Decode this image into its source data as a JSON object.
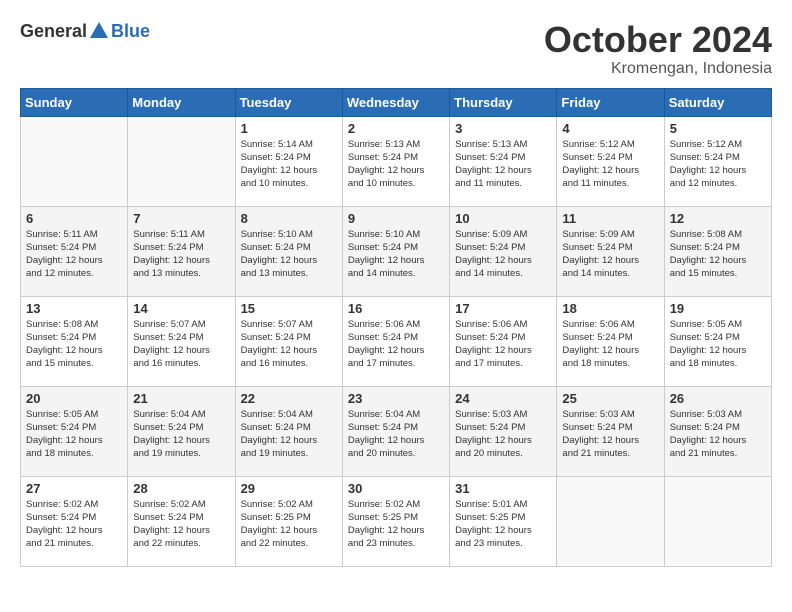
{
  "logo": {
    "general": "General",
    "blue": "Blue"
  },
  "title": "October 2024",
  "location": "Kromengan, Indonesia",
  "days_of_week": [
    "Sunday",
    "Monday",
    "Tuesday",
    "Wednesday",
    "Thursday",
    "Friday",
    "Saturday"
  ],
  "weeks": [
    [
      {
        "day": "",
        "info": ""
      },
      {
        "day": "",
        "info": ""
      },
      {
        "day": "1",
        "sunrise": "5:14 AM",
        "sunset": "5:24 PM",
        "daylight": "12 hours and 10 minutes."
      },
      {
        "day": "2",
        "sunrise": "5:13 AM",
        "sunset": "5:24 PM",
        "daylight": "12 hours and 10 minutes."
      },
      {
        "day": "3",
        "sunrise": "5:13 AM",
        "sunset": "5:24 PM",
        "daylight": "12 hours and 11 minutes."
      },
      {
        "day": "4",
        "sunrise": "5:12 AM",
        "sunset": "5:24 PM",
        "daylight": "12 hours and 11 minutes."
      },
      {
        "day": "5",
        "sunrise": "5:12 AM",
        "sunset": "5:24 PM",
        "daylight": "12 hours and 12 minutes."
      }
    ],
    [
      {
        "day": "6",
        "sunrise": "5:11 AM",
        "sunset": "5:24 PM",
        "daylight": "12 hours and 12 minutes."
      },
      {
        "day": "7",
        "sunrise": "5:11 AM",
        "sunset": "5:24 PM",
        "daylight": "12 hours and 13 minutes."
      },
      {
        "day": "8",
        "sunrise": "5:10 AM",
        "sunset": "5:24 PM",
        "daylight": "12 hours and 13 minutes."
      },
      {
        "day": "9",
        "sunrise": "5:10 AM",
        "sunset": "5:24 PM",
        "daylight": "12 hours and 14 minutes."
      },
      {
        "day": "10",
        "sunrise": "5:09 AM",
        "sunset": "5:24 PM",
        "daylight": "12 hours and 14 minutes."
      },
      {
        "day": "11",
        "sunrise": "5:09 AM",
        "sunset": "5:24 PM",
        "daylight": "12 hours and 14 minutes."
      },
      {
        "day": "12",
        "sunrise": "5:08 AM",
        "sunset": "5:24 PM",
        "daylight": "12 hours and 15 minutes."
      }
    ],
    [
      {
        "day": "13",
        "sunrise": "5:08 AM",
        "sunset": "5:24 PM",
        "daylight": "12 hours and 15 minutes."
      },
      {
        "day": "14",
        "sunrise": "5:07 AM",
        "sunset": "5:24 PM",
        "daylight": "12 hours and 16 minutes."
      },
      {
        "day": "15",
        "sunrise": "5:07 AM",
        "sunset": "5:24 PM",
        "daylight": "12 hours and 16 minutes."
      },
      {
        "day": "16",
        "sunrise": "5:06 AM",
        "sunset": "5:24 PM",
        "daylight": "12 hours and 17 minutes."
      },
      {
        "day": "17",
        "sunrise": "5:06 AM",
        "sunset": "5:24 PM",
        "daylight": "12 hours and 17 minutes."
      },
      {
        "day": "18",
        "sunrise": "5:06 AM",
        "sunset": "5:24 PM",
        "daylight": "12 hours and 18 minutes."
      },
      {
        "day": "19",
        "sunrise": "5:05 AM",
        "sunset": "5:24 PM",
        "daylight": "12 hours and 18 minutes."
      }
    ],
    [
      {
        "day": "20",
        "sunrise": "5:05 AM",
        "sunset": "5:24 PM",
        "daylight": "12 hours and 18 minutes."
      },
      {
        "day": "21",
        "sunrise": "5:04 AM",
        "sunset": "5:24 PM",
        "daylight": "12 hours and 19 minutes."
      },
      {
        "day": "22",
        "sunrise": "5:04 AM",
        "sunset": "5:24 PM",
        "daylight": "12 hours and 19 minutes."
      },
      {
        "day": "23",
        "sunrise": "5:04 AM",
        "sunset": "5:24 PM",
        "daylight": "12 hours and 20 minutes."
      },
      {
        "day": "24",
        "sunrise": "5:03 AM",
        "sunset": "5:24 PM",
        "daylight": "12 hours and 20 minutes."
      },
      {
        "day": "25",
        "sunrise": "5:03 AM",
        "sunset": "5:24 PM",
        "daylight": "12 hours and 21 minutes."
      },
      {
        "day": "26",
        "sunrise": "5:03 AM",
        "sunset": "5:24 PM",
        "daylight": "12 hours and 21 minutes."
      }
    ],
    [
      {
        "day": "27",
        "sunrise": "5:02 AM",
        "sunset": "5:24 PM",
        "daylight": "12 hours and 21 minutes."
      },
      {
        "day": "28",
        "sunrise": "5:02 AM",
        "sunset": "5:24 PM",
        "daylight": "12 hours and 22 minutes."
      },
      {
        "day": "29",
        "sunrise": "5:02 AM",
        "sunset": "5:25 PM",
        "daylight": "12 hours and 22 minutes."
      },
      {
        "day": "30",
        "sunrise": "5:02 AM",
        "sunset": "5:25 PM",
        "daylight": "12 hours and 23 minutes."
      },
      {
        "day": "31",
        "sunrise": "5:01 AM",
        "sunset": "5:25 PM",
        "daylight": "12 hours and 23 minutes."
      },
      {
        "day": "",
        "info": ""
      },
      {
        "day": "",
        "info": ""
      }
    ]
  ],
  "labels": {
    "sunrise": "Sunrise:",
    "sunset": "Sunset:",
    "daylight": "Daylight: 12 hours"
  }
}
